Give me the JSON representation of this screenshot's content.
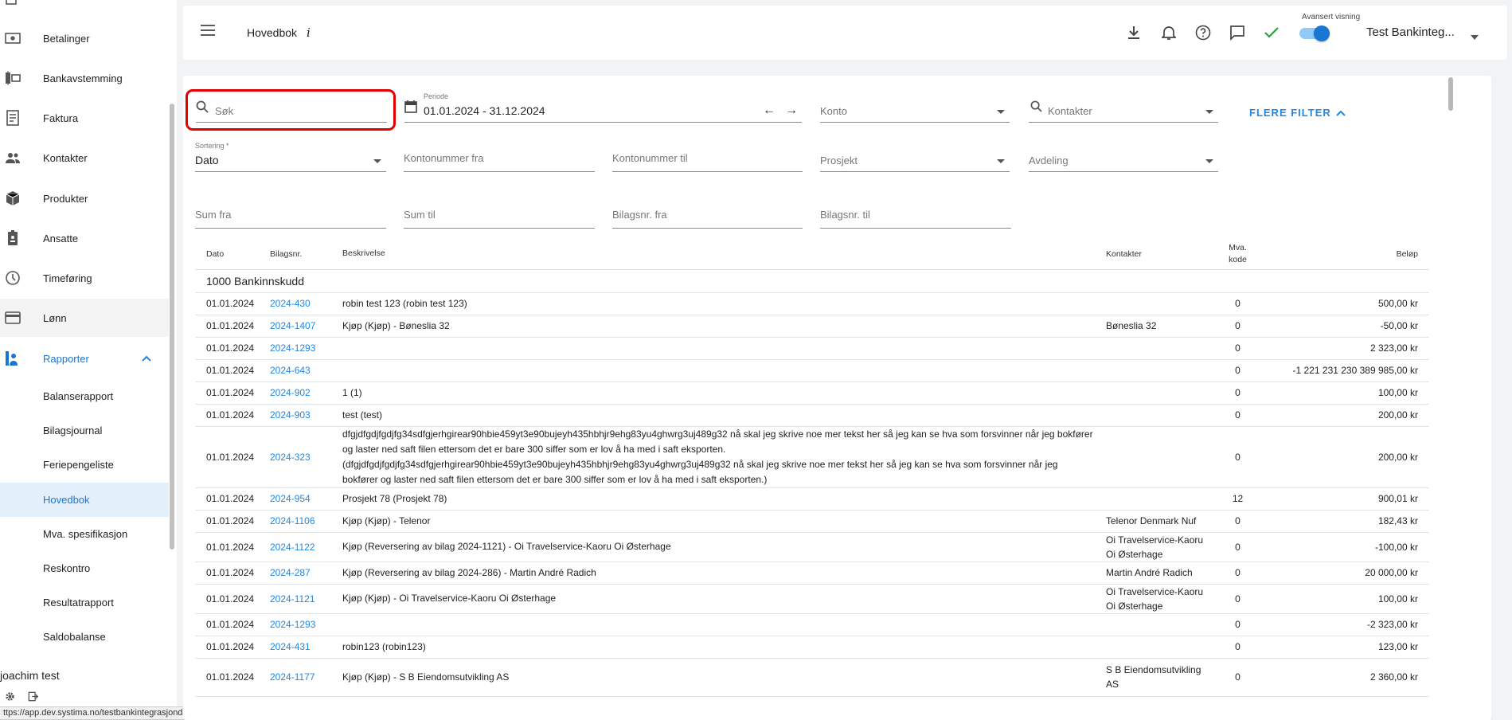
{
  "sidebar": {
    "items": [
      {
        "label": "Betalinger",
        "icon": "payment-icon"
      },
      {
        "label": "Bankavstemming",
        "icon": "bank-reconcile-icon"
      },
      {
        "label": "Faktura",
        "icon": "invoice-icon"
      },
      {
        "label": "Kontakter",
        "icon": "people-icon"
      },
      {
        "label": "Produkter",
        "icon": "box-icon"
      },
      {
        "label": "Ansatte",
        "icon": "badge-icon"
      },
      {
        "label": "Timeføring",
        "icon": "clock-icon"
      },
      {
        "label": "Lønn",
        "icon": "card-icon"
      },
      {
        "label": "Rapporter",
        "icon": "report-icon"
      }
    ],
    "sub_items": [
      {
        "label": "Balanserapport"
      },
      {
        "label": "Bilagsjournal"
      },
      {
        "label": "Feriepengeliste"
      },
      {
        "label": "Hovedbok"
      },
      {
        "label": "Mva. spesifikasjon"
      },
      {
        "label": "Reskontro"
      },
      {
        "label": "Resultatrapport"
      },
      {
        "label": "Saldobalanse"
      }
    ],
    "user_name": "joachim test",
    "status_url": "ttps://app.dev.systima.no/testbankintegrasjondnb/salary"
  },
  "header": {
    "title": "Hovedbok",
    "info": "i",
    "advanced_label": "Avansert visning",
    "company": "Test Bankinteg...",
    "accent": "#1976d2"
  },
  "filters": {
    "search_placeholder": "Søk",
    "period_label": "Periode",
    "period_value": "01.01.2024 - 31.12.2024",
    "arrow_left": "←",
    "arrow_right": "→",
    "konto_placeholder": "Konto",
    "kontakter_placeholder": "Kontakter",
    "more_filters": "FLERE FILTER",
    "sort_label": "Sortering *",
    "sort_value": "Dato",
    "kontonummer_fra": "Kontonummer fra",
    "kontonummer_til": "Kontonummer til",
    "prosjekt": "Prosjekt",
    "avdeling": "Avdeling",
    "sum_fra": "Sum fra",
    "sum_til": "Sum til",
    "bilagsnr_fra": "Bilagsnr. fra",
    "bilagsnr_til": "Bilagsnr. til"
  },
  "table": {
    "headers": {
      "dato": "Dato",
      "bilagsnr": "Bilagsnr.",
      "beskrivelse": "Beskrivelse",
      "kontakter": "Kontakter",
      "mva_1": "Mva.",
      "mva_2": "kode",
      "belop": "Beløp"
    },
    "group": "1000 Bankinnskudd",
    "rows": [
      {
        "dato": "01.01.2024",
        "bilagsnr": "2024-430",
        "beskrivelse": "robin test 123 (robin test 123)",
        "kontakter": "",
        "mva": "0",
        "belop": "500,00 kr"
      },
      {
        "dato": "01.01.2024",
        "bilagsnr": "2024-1407",
        "beskrivelse": "Kjøp (Kjøp) - Bøneslia 32",
        "kontakter": "Bøneslia 32",
        "mva": "0",
        "belop": "-50,00 kr"
      },
      {
        "dato": "01.01.2024",
        "bilagsnr": "2024-1293",
        "beskrivelse": "",
        "kontakter": "",
        "mva": "0",
        "belop": "2 323,00 kr"
      },
      {
        "dato": "01.01.2024",
        "bilagsnr": "2024-643",
        "beskrivelse": "",
        "kontakter": "",
        "mva": "0",
        "belop": "-1 221 231 230 389 985,00 kr"
      },
      {
        "dato": "01.01.2024",
        "bilagsnr": "2024-902",
        "beskrivelse": "1 (1)",
        "kontakter": "",
        "mva": "0",
        "belop": "100,00 kr"
      },
      {
        "dato": "01.01.2024",
        "bilagsnr": "2024-903",
        "beskrivelse": "test (test)",
        "kontakter": "",
        "mva": "0",
        "belop": "200,00 kr"
      },
      {
        "dato": "01.01.2024",
        "bilagsnr": "2024-323",
        "beskrivelse": "dfgjdfgdjfgdjfg34sdfgjerhgirear90hbie459yt3e90bujeyh435hbhjr9ehg83yu4ghwrg3uj489g32 nå skal jeg skrive noe mer tekst her så jeg kan se hva som forsvinner når jeg bokfører og laster ned saft filen ettersom det er bare 300 siffer som er lov å ha med i saft eksporten. (dfgjdfgdjfgdjfg34sdfgjerhgirear90hbie459yt3e90bujeyh435hbhjr9ehg83yu4ghwrg3uj489g32 nå skal jeg skrive noe mer tekst her så jeg kan se hva som forsvinner når jeg bokfører og laster ned saft filen ettersom det er bare 300 siffer som er lov å ha med i saft eksporten.)",
        "kontakter": "",
        "mva": "0",
        "belop": "200,00 kr"
      },
      {
        "dato": "01.01.2024",
        "bilagsnr": "2024-954",
        "beskrivelse": "Prosjekt 78 (Prosjekt 78)",
        "kontakter": "",
        "mva": "12",
        "belop": "900,01 kr"
      },
      {
        "dato": "01.01.2024",
        "bilagsnr": "2024-1106",
        "beskrivelse": "Kjøp (Kjøp) - Telenor",
        "kontakter": "Telenor Denmark Nuf",
        "mva": "0",
        "belop": "182,43 kr"
      },
      {
        "dato": "01.01.2024",
        "bilagsnr": "2024-1122",
        "beskrivelse": "Kjøp (Reversering av bilag 2024-1121) - Oi Travelservice-Kaoru Oi Østerhage",
        "kontakter": "Oi Travelservice-Kaoru Oi Østerhage",
        "mva": "0",
        "belop": "-100,00 kr"
      },
      {
        "dato": "01.01.2024",
        "bilagsnr": "2024-287",
        "beskrivelse": "Kjøp (Reversering av bilag 2024-286) - Martin André Radich",
        "kontakter": "Martin André Radich",
        "mva": "0",
        "belop": "20 000,00 kr"
      },
      {
        "dato": "01.01.2024",
        "bilagsnr": "2024-1121",
        "beskrivelse": "Kjøp (Kjøp) - Oi Travelservice-Kaoru Oi Østerhage",
        "kontakter": "Oi Travelservice-Kaoru Oi Østerhage",
        "mva": "0",
        "belop": "100,00 kr"
      },
      {
        "dato": "01.01.2024",
        "bilagsnr": "2024-1293",
        "beskrivelse": "",
        "kontakter": "",
        "mva": "0",
        "belop": "-2 323,00 kr"
      },
      {
        "dato": "01.01.2024",
        "bilagsnr": "2024-431",
        "beskrivelse": "robin123 (robin123)",
        "kontakter": "",
        "mva": "0",
        "belop": "123,00 kr"
      },
      {
        "dato": "01.01.2024",
        "bilagsnr": "2024-1177",
        "beskrivelse": "Kjøp (Kjøp) - S B Eiendomsutvikling AS",
        "kontakter": "S B Eiendomsutvikling AS",
        "mva": "0",
        "belop": "2 360,00 kr"
      }
    ]
  }
}
